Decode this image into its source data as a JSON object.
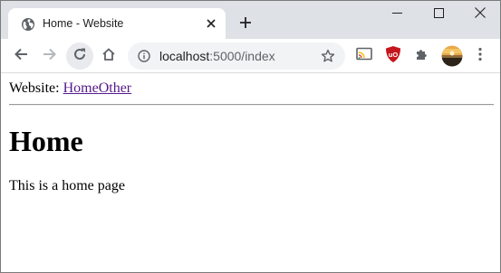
{
  "browser": {
    "tab": {
      "title": "Home - Website",
      "favicon": "globe-icon",
      "close_icon": "close-icon"
    },
    "new_tab_icon": "plus-icon",
    "window_controls": {
      "minimize_icon": "minimize-icon",
      "maximize_icon": "maximize-icon",
      "close_icon": "close-icon"
    },
    "toolbar": {
      "back_icon": "back-arrow-icon",
      "forward_icon": "forward-arrow-icon",
      "reload_icon": "reload-icon",
      "home_icon": "home-icon",
      "address": {
        "host": "localhost",
        "path": ":5000/index",
        "info_icon": "info-icon",
        "bookmark_icon": "star-icon"
      },
      "extensions": [
        "cast-icon",
        "ublock-icon",
        "puzzle-icon",
        "avatar",
        "kebab-menu-icon"
      ]
    }
  },
  "page": {
    "site_label": "Website: ",
    "links": [
      "Home",
      "Other"
    ],
    "heading": "Home",
    "body_text": "This is a home page"
  },
  "colors": {
    "tabstrip_bg": "#dee1e6",
    "omnibox_bg": "#f1f3f4",
    "visited_link": "#551a8b",
    "ublock_red": "#c4161c"
  }
}
